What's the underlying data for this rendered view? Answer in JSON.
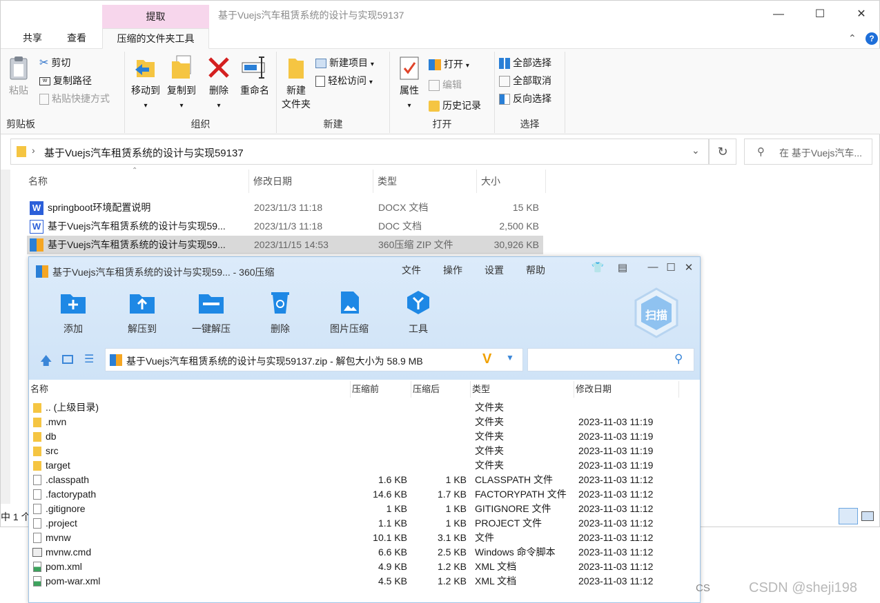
{
  "explorer": {
    "window_title": "基于Vuejs汽车租赁系统的设计与实现59137",
    "context_tab_header": "提取",
    "tabs": [
      {
        "label": "共享"
      },
      {
        "label": "查看"
      },
      {
        "label": "压缩的文件夹工具"
      }
    ],
    "ribbon": {
      "clipboard": {
        "label": "剪贴板",
        "paste": "粘贴",
        "cut": "剪切",
        "copy_path": "复制路径",
        "paste_shortcut": "粘贴快捷方式"
      },
      "organize": {
        "label": "组织",
        "move_to": "移动到",
        "copy_to": "复制到",
        "delete": "删除",
        "rename": "重命名"
      },
      "new": {
        "label": "新建",
        "new_folder": "新建\n文件夹",
        "new_item": "新建项目",
        "easy_access": "轻松访问"
      },
      "open": {
        "label": "打开",
        "properties": "属性",
        "open": "打开",
        "edit": "编辑",
        "history": "历史记录"
      },
      "select": {
        "label": "选择",
        "select_all": "全部选择",
        "select_none": "全部取消",
        "invert": "反向选择"
      }
    },
    "address": {
      "path": "基于Vuejs汽车租赁系统的设计与实现59137",
      "search_placeholder": "在 基于Vuejs汽车..."
    },
    "columns": {
      "name": "名称",
      "date": "修改日期",
      "type": "类型",
      "size": "大小"
    },
    "files": [
      {
        "name": "springboot环境配置说明",
        "date": "2023/11/3 11:18",
        "type": "DOCX 文档",
        "size": "15 KB",
        "icon": "wps-icon"
      },
      {
        "name": "基于Vuejs汽车租赁系统的设计与实现59...",
        "date": "2023/11/3 11:18",
        "type": "DOC 文档",
        "size": "2,500 KB",
        "icon": "word-icon"
      },
      {
        "name": "基于Vuejs汽车租赁系统的设计与实现59...",
        "date": "2023/11/15 14:53",
        "type": "360压缩 ZIP 文件",
        "size": "30,926 KB",
        "icon": "zip-icon",
        "selected": true
      }
    ],
    "status": "中 1 个"
  },
  "zip": {
    "title": "基于Vuejs汽车租赁系统的设计与实现59... - 360压缩",
    "menu": [
      "文件",
      "操作",
      "设置",
      "帮助"
    ],
    "tools": [
      {
        "label": "添加",
        "icon": "add-icon"
      },
      {
        "label": "解压到",
        "icon": "extract-to-icon"
      },
      {
        "label": "一键解压",
        "icon": "one-click-extract-icon"
      },
      {
        "label": "删除",
        "icon": "delete-icon"
      },
      {
        "label": "图片压缩",
        "icon": "image-compress-icon"
      },
      {
        "label": "工具",
        "icon": "tools-icon"
      }
    ],
    "scan_label": "扫描",
    "path": "基于Vuejs汽车租赁系统的设计与实现59137.zip - 解包大小为 58.9 MB",
    "columns": {
      "name": "名称",
      "packed": "压缩前",
      "unpacked": "压缩后",
      "type": "类型",
      "date": "修改日期"
    },
    "entries": [
      {
        "name": ".. (上级目录)",
        "before": "",
        "after": "",
        "type": "文件夹",
        "date": "",
        "kind": "folder"
      },
      {
        "name": ".mvn",
        "before": "",
        "after": "",
        "type": "文件夹",
        "date": "2023-11-03 11:19",
        "kind": "folder"
      },
      {
        "name": "db",
        "before": "",
        "after": "",
        "type": "文件夹",
        "date": "2023-11-03 11:19",
        "kind": "folder"
      },
      {
        "name": "src",
        "before": "",
        "after": "",
        "type": "文件夹",
        "date": "2023-11-03 11:19",
        "kind": "folder"
      },
      {
        "name": "target",
        "before": "",
        "after": "",
        "type": "文件夹",
        "date": "2023-11-03 11:19",
        "kind": "folder"
      },
      {
        "name": ".classpath",
        "before": "1.6 KB",
        "after": "1 KB",
        "type": "CLASSPATH 文件",
        "date": "2023-11-03 11:12",
        "kind": "file"
      },
      {
        "name": ".factorypath",
        "before": "14.6 KB",
        "after": "1.7 KB",
        "type": "FACTORYPATH 文件",
        "date": "2023-11-03 11:12",
        "kind": "file"
      },
      {
        "name": ".gitignore",
        "before": "1 KB",
        "after": "1 KB",
        "type": "GITIGNORE 文件",
        "date": "2023-11-03 11:12",
        "kind": "file"
      },
      {
        "name": ".project",
        "before": "1.1 KB",
        "after": "1 KB",
        "type": "PROJECT 文件",
        "date": "2023-11-03 11:12",
        "kind": "file"
      },
      {
        "name": "mvnw",
        "before": "10.1 KB",
        "after": "3.1 KB",
        "type": "文件",
        "date": "2023-11-03 11:12",
        "kind": "file"
      },
      {
        "name": "mvnw.cmd",
        "before": "6.6 KB",
        "after": "2.5 KB",
        "type": "Windows 命令脚本",
        "date": "2023-11-03 11:12",
        "kind": "cmd"
      },
      {
        "name": "pom.xml",
        "before": "4.9 KB",
        "after": "1.2 KB",
        "type": "XML 文档",
        "date": "2023-11-03 11:12",
        "kind": "xml"
      },
      {
        "name": "pom-war.xml",
        "before": "4.5 KB",
        "after": "1.2 KB",
        "type": "XML 文档",
        "date": "2023-11-03 11:12",
        "kind": "xml"
      }
    ]
  },
  "watermark": {
    "cs": "CS",
    "text": "CSDN @sheji198"
  },
  "colors": {
    "accent_blue": "#1e88e5",
    "folder_yellow": "#f5c542",
    "selection_gray": "#d9d9d9",
    "zip_header": "#dcebfa"
  }
}
